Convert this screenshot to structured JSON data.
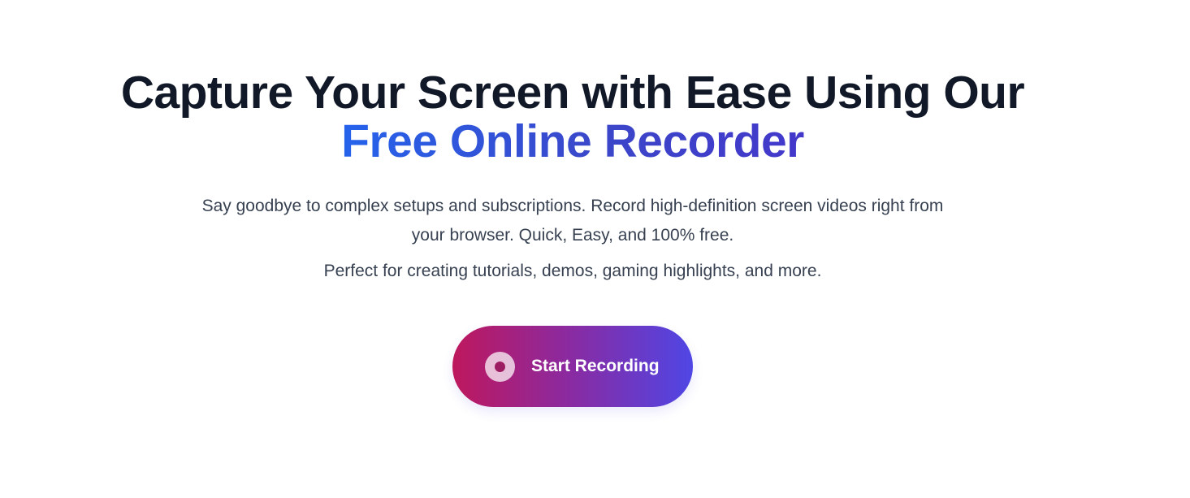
{
  "hero": {
    "title_line1": "Capture Your Screen with Ease Using Our",
    "title_line2": "Free Online Recorder",
    "subtitle": "Say goodbye to complex setups and subscriptions. Record high-definition screen videos right from your browser. Quick, Easy, and 100% free.",
    "subnote": "Perfect for creating tutorials, demos, gaming highlights, and more."
  },
  "cta": {
    "label": "Start Recording",
    "icon": "record-icon"
  },
  "colors": {
    "heading": "#111827",
    "accent_start": "#2563eb",
    "accent_end": "#4338ca",
    "button_start": "#be185d",
    "button_end": "#4f46e5",
    "body_text": "#374151"
  }
}
